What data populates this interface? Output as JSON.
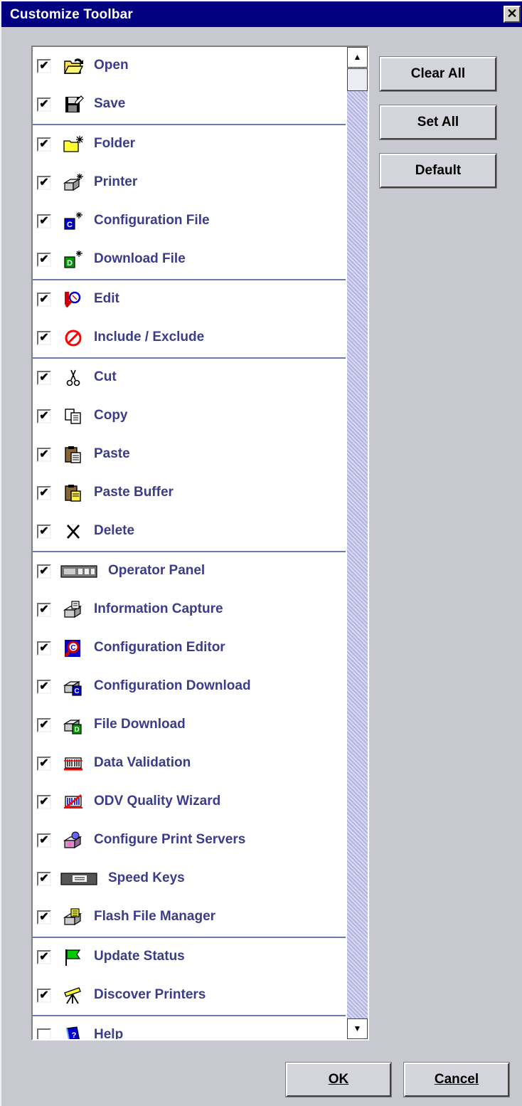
{
  "dialog": {
    "title": "Customize Toolbar",
    "close_label": "✕"
  },
  "toolbar_items": {
    "open": {
      "label": "Open",
      "checked": true,
      "icon": "folder-open-icon"
    },
    "save": {
      "label": "Save",
      "checked": true,
      "icon": "floppy-save-icon"
    },
    "folder": {
      "label": "Folder",
      "checked": true,
      "icon": "new-folder-icon"
    },
    "printer": {
      "label": "Printer",
      "checked": true,
      "icon": "new-printer-icon"
    },
    "config_file": {
      "label": "Configuration File",
      "checked": true,
      "icon": "new-config-file-icon"
    },
    "download_file": {
      "label": "Download File",
      "checked": true,
      "icon": "new-download-file-icon"
    },
    "edit": {
      "label": "Edit",
      "checked": true,
      "icon": "edit-magnifier-icon"
    },
    "include_exclude": {
      "label": "Include / Exclude",
      "checked": true,
      "icon": "prohibited-icon"
    },
    "cut": {
      "label": "Cut",
      "checked": true,
      "icon": "scissors-icon"
    },
    "copy": {
      "label": "Copy",
      "checked": true,
      "icon": "copy-icon"
    },
    "paste": {
      "label": "Paste",
      "checked": true,
      "icon": "clipboard-icon"
    },
    "paste_buffer": {
      "label": "Paste Buffer",
      "checked": true,
      "icon": "clipboard-buffer-icon"
    },
    "delete": {
      "label": "Delete",
      "checked": true,
      "icon": "delete-x-icon"
    },
    "operator_panel": {
      "label": "Operator Panel",
      "checked": true,
      "icon": "operator-panel-icon"
    },
    "info_capture": {
      "label": "Information Capture",
      "checked": true,
      "icon": "info-capture-printer-icon"
    },
    "config_editor": {
      "label": "Configuration Editor",
      "checked": true,
      "icon": "config-editor-icon"
    },
    "config_download": {
      "label": "Configuration Download",
      "checked": true,
      "icon": "config-download-printer-icon"
    },
    "file_download": {
      "label": "File Download",
      "checked": true,
      "icon": "file-download-printer-icon"
    },
    "data_validation": {
      "label": "Data Validation",
      "checked": true,
      "icon": "data-validation-icon"
    },
    "odv_wizard": {
      "label": "ODV Quality Wizard",
      "checked": true,
      "icon": "odv-wizard-icon"
    },
    "print_servers": {
      "label": "Configure Print Servers",
      "checked": true,
      "icon": "print-server-icon"
    },
    "speed_keys": {
      "label": "Speed Keys",
      "checked": true,
      "icon": "keyboard-icon"
    },
    "flash_manager": {
      "label": "Flash File Manager",
      "checked": true,
      "icon": "flash-file-printer-icon"
    },
    "update_status": {
      "label": "Update Status",
      "checked": true,
      "icon": "green-flag-icon"
    },
    "discover": {
      "label": "Discover Printers",
      "checked": true,
      "icon": "telescope-icon"
    },
    "help": {
      "label": "Help",
      "checked": false,
      "icon": "help-book-icon"
    }
  },
  "check_glyph": "✔",
  "scroll": {
    "up": "▲",
    "down": "▼"
  },
  "buttons": {
    "clear_all": "Clear All",
    "set_all": "Set All",
    "default": "Default",
    "ok": "OK",
    "cancel": "Cancel"
  },
  "colors": {
    "title_bar": "#000080",
    "label_text": "#3c3c8c",
    "separator": "#6d7cb0"
  }
}
